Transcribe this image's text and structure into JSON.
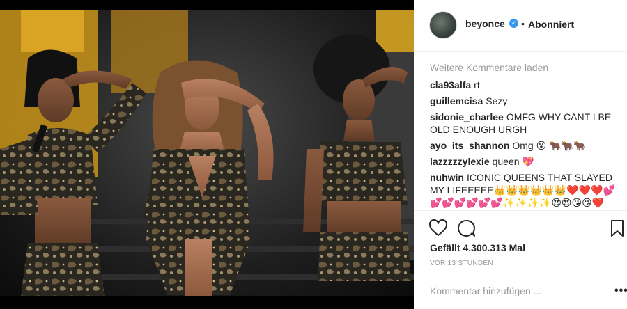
{
  "post": {
    "image_description_icon": "concert-photo",
    "username": "beyonce",
    "verified_icon": "verified-badge-icon",
    "separator": "•",
    "follow_status": "Abonniert"
  },
  "comments": {
    "load_more": "Weitere Kommentare laden",
    "items": [
      {
        "user": "cla93alfa",
        "text": "rt"
      },
      {
        "user": "guillemcisa",
        "text": "Sezy"
      },
      {
        "user": "sidonie_charlee",
        "text": "OMFG WHY CANT I BE OLD ENOUGH URGH"
      },
      {
        "user": "ayo_its_shannon",
        "text": "Omg 😮 🐂🐂🐂"
      },
      {
        "user": "lazzzzzylexie",
        "text": "queen 💖"
      },
      {
        "user": "nuhwin",
        "text": "ICONIC QUEENS THAT SLAYED MY LIFEEEEE👑👑👑👑👑👑❤️❤️❤️💕💕💕💕💕💕💕✨✨✨✨😍😍😘😘❤️"
      }
    ]
  },
  "actions": {
    "like_icon": "heart-icon",
    "comment_icon": "comment-icon",
    "save_icon": "bookmark-icon",
    "likes_text": "Gefällt 4.300.313 Mal",
    "timestamp": "VOR 13 STUNDEN"
  },
  "add_comment": {
    "placeholder": "Kommentar hinzufügen ...",
    "more_label": "•••"
  }
}
